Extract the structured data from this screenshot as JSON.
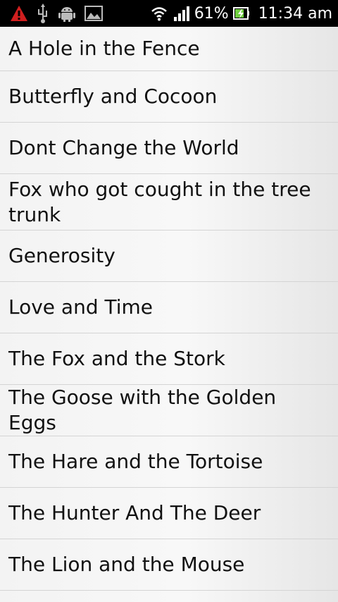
{
  "status_bar": {
    "icons_left": [
      "warning-icon",
      "usb-icon",
      "android-debug-icon",
      "image-icon"
    ],
    "icons_right": [
      "wifi-icon",
      "signal-icon",
      "battery-charging-icon"
    ],
    "battery_percent": "61%",
    "time": "11:34 am",
    "warning_color": "#d01f1f"
  },
  "stories": {
    "items": [
      {
        "label": "A Hole in the Fence"
      },
      {
        "label": "Butterfly and Cocoon"
      },
      {
        "label": "Dont Change the World"
      },
      {
        "label": "Fox who got cought in the tree trunk"
      },
      {
        "label": "Generosity"
      },
      {
        "label": "Love and Time"
      },
      {
        "label": "The Fox and the Stork"
      },
      {
        "label": "The Goose with the Golden Eggs"
      },
      {
        "label": "The Hare and the Tortoise"
      },
      {
        "label": "The Hunter And The Deer"
      },
      {
        "label": "The Lion and the Mouse"
      },
      {
        "label": ""
      }
    ]
  }
}
